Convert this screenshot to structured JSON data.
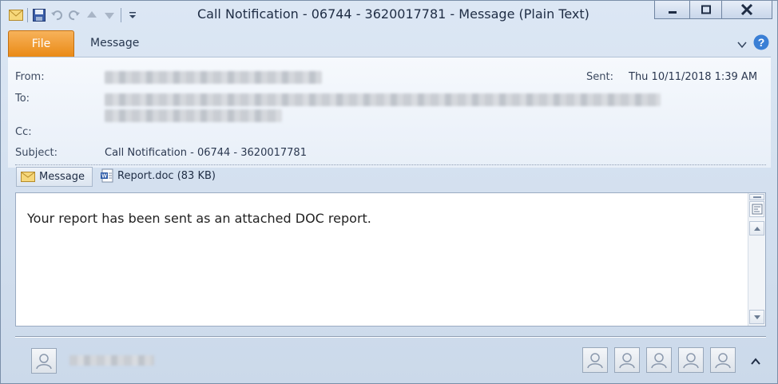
{
  "window": {
    "title": "Call Notification - 06744 - 3620017781  -  Message (Plain Text)"
  },
  "ribbon": {
    "tab_file": "File",
    "tab_message": "Message"
  },
  "header": {
    "from_label": "From:",
    "to_label": "To:",
    "cc_label": "Cc:",
    "subject_label": "Subject:",
    "subject_value": "Call Notification - 06744 - 3620017781",
    "sent_label": "Sent:",
    "sent_value": "Thu 10/11/2018 1:39 AM"
  },
  "attachments": {
    "message_tab": "Message",
    "file": "Report.doc (83 KB)"
  },
  "body": {
    "text": "Your report has been sent as an attached DOC report."
  },
  "icons": {
    "app": "envelope-icon",
    "save": "save-icon",
    "undo": "undo-icon",
    "redo": "redo-icon",
    "prev": "up-arrow-icon",
    "next": "down-arrow-icon",
    "customize": "customize-qat-icon",
    "help": "help-icon"
  },
  "colors": {
    "file_tab": "#ea8a16",
    "title_bar": "#dce7f4",
    "help": "#3a7fd5"
  }
}
